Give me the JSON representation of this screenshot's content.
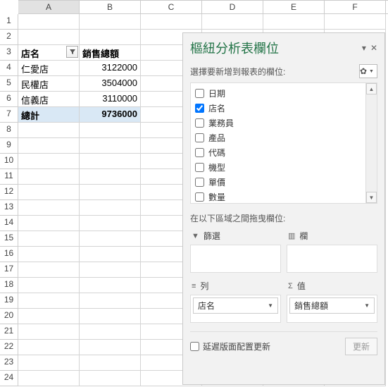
{
  "columns": [
    "A",
    "B",
    "C",
    "D",
    "E",
    "F"
  ],
  "rowcount": 24,
  "pivot_headers": {
    "c1": "店名",
    "c2": "銷售總額"
  },
  "pivot_rows": [
    {
      "name": "仁愛店",
      "val": "3122000"
    },
    {
      "name": "民權店",
      "val": "3504000"
    },
    {
      "name": "信義店",
      "val": "3110000"
    }
  ],
  "pivot_total": {
    "label": "總計",
    "val": "9736000"
  },
  "pane": {
    "title": "樞紐分析表欄位",
    "subtitle": "選擇要新增到報表的欄位:",
    "fields": [
      {
        "label": "日期",
        "checked": false
      },
      {
        "label": "店名",
        "checked": true,
        "filter": true
      },
      {
        "label": "業務員",
        "checked": false
      },
      {
        "label": "產品",
        "checked": false
      },
      {
        "label": "代碼",
        "checked": false
      },
      {
        "label": "機型",
        "checked": false
      },
      {
        "label": "單價",
        "checked": false
      },
      {
        "label": "數量",
        "checked": false
      }
    ],
    "drag_label": "在以下區域之間拖曳欄位:",
    "areas": {
      "filter": "篩選",
      "columns": "欄",
      "rows": "列",
      "values": "值"
    },
    "row_item": "店名",
    "val_item": "銷售總額",
    "defer_label": "延遲版面配置更新",
    "update_btn": "更新"
  },
  "chart_data": {
    "type": "table",
    "title": "銷售總額 by 店名",
    "columns": [
      "店名",
      "銷售總額"
    ],
    "rows": [
      [
        "仁愛店",
        3122000
      ],
      [
        "民權店",
        3504000
      ],
      [
        "信義店",
        3110000
      ]
    ],
    "total": [
      "總計",
      9736000
    ]
  }
}
